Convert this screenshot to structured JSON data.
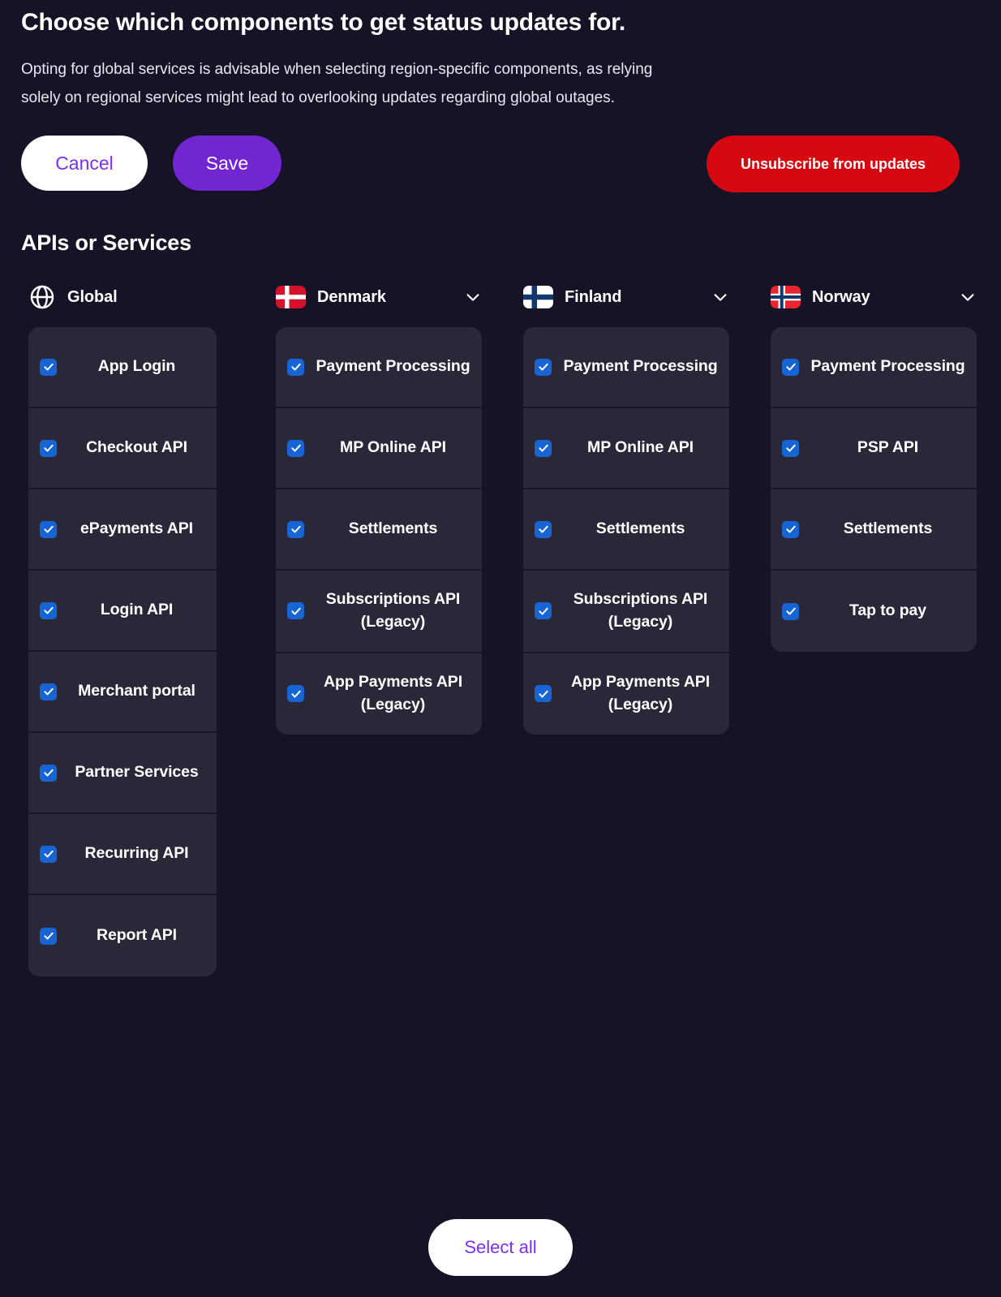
{
  "header": {
    "title": "Choose which components to get status updates for.",
    "description": "Opting for global services is advisable when selecting region-specific components, as relying solely on regional services might lead to overlooking updates regarding global outages."
  },
  "actions": {
    "cancel_label": "Cancel",
    "save_label": "Save",
    "unsubscribe_label": "Unsubscribe from updates",
    "select_all_label": "Select all"
  },
  "colors": {
    "page_background": "#161327",
    "card_background": "#2a2739",
    "accent_purple": "#7226d1",
    "danger_red": "#d60812",
    "checkbox_blue": "#1764d4",
    "link_purple": "#7b2ff7"
  },
  "section": {
    "title": "APIs or Services"
  },
  "columns": [
    {
      "name": "Global",
      "icon": "globe-icon",
      "has_chevron": false,
      "items": [
        {
          "label": "App Login",
          "checked": true
        },
        {
          "label": "Checkout API",
          "checked": true
        },
        {
          "label": "ePayments API",
          "checked": true
        },
        {
          "label": "Login API",
          "checked": true
        },
        {
          "label": "Merchant portal",
          "checked": true
        },
        {
          "label": "Partner Services",
          "checked": true
        },
        {
          "label": "Recurring API",
          "checked": true
        },
        {
          "label": "Report API",
          "checked": true
        }
      ]
    },
    {
      "name": "Denmark",
      "icon": "flag-denmark-icon",
      "has_chevron": true,
      "chevron_icon": "chevron-down-icon",
      "items": [
        {
          "label": "Payment Processing",
          "checked": true
        },
        {
          "label": "MP Online API",
          "checked": true
        },
        {
          "label": "Settlements",
          "checked": true
        },
        {
          "label": "Subscriptions API (Legacy)",
          "checked": true
        },
        {
          "label": "App Payments API (Legacy)",
          "checked": true
        }
      ]
    },
    {
      "name": "Finland",
      "icon": "flag-finland-icon",
      "has_chevron": true,
      "chevron_icon": "chevron-down-icon",
      "items": [
        {
          "label": "Payment Processing",
          "checked": true
        },
        {
          "label": "MP Online API",
          "checked": true
        },
        {
          "label": "Settlements",
          "checked": true
        },
        {
          "label": "Subscriptions API (Legacy)",
          "checked": true
        },
        {
          "label": "App Payments API (Legacy)",
          "checked": true
        }
      ]
    },
    {
      "name": "Norway",
      "icon": "flag-norway-icon",
      "has_chevron": true,
      "chevron_icon": "chevron-down-icon",
      "items": [
        {
          "label": "Payment Processing",
          "checked": true
        },
        {
          "label": "PSP API",
          "checked": true
        },
        {
          "label": "Settlements",
          "checked": true
        },
        {
          "label": "Tap to pay",
          "checked": true
        }
      ]
    }
  ]
}
